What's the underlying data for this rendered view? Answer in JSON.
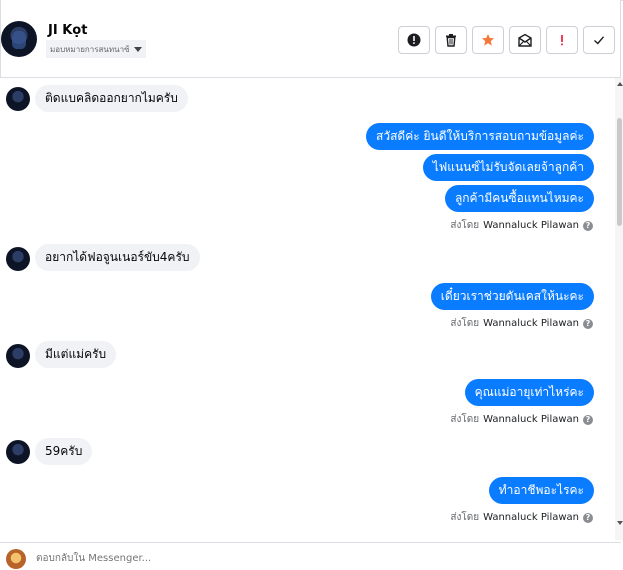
{
  "header": {
    "contact_name": "JI Kọt",
    "assign_label": "มอบหมายการสนทนาซ้"
  },
  "actions": [
    {
      "name": "report-spam",
      "glyph": "!"
    },
    {
      "name": "delete",
      "glyph": "trash"
    },
    {
      "name": "star",
      "glyph": "star"
    },
    {
      "name": "mark-unread",
      "glyph": "envelope"
    },
    {
      "name": "follow-up",
      "glyph": "!"
    },
    {
      "name": "done",
      "glyph": "check"
    }
  ],
  "colors": {
    "outgoing_bubble": "#0a7cff",
    "incoming_bubble": "#f0f2f5",
    "follow_up": "#f02849",
    "star": "#f5793b"
  },
  "messages": [
    {
      "dir": "in",
      "text": "ติดแบคลิดออกยากไมครับ"
    },
    {
      "dir": "out",
      "text": "สวัสดีค่ะ  ยินดีให้บริการสอบถามข้อมูลค่ะ"
    },
    {
      "dir": "out",
      "text": "ไฟแนนซ์ไม่รับจัดเลยจ้าลูกค้า"
    },
    {
      "dir": "out",
      "text": "ลูกค้ามีคนซื้อแทนไหมคะ"
    },
    {
      "dir": "sent",
      "prefix": "ส่งโดย",
      "agent": "Wannaluck Pilawan"
    },
    {
      "dir": "in",
      "text": "อยากได้ฟอจูนเนอร์ขับ4ครับ"
    },
    {
      "dir": "out",
      "text": "เดี๋ยวเราช่วยดันเคสให้นะคะ"
    },
    {
      "dir": "sent",
      "prefix": "ส่งโดย",
      "agent": "Wannaluck Pilawan"
    },
    {
      "dir": "in",
      "text": "มีแต่แม่ครับ"
    },
    {
      "dir": "out",
      "text": "คุณแม่อายุเท่าไหร่คะ"
    },
    {
      "dir": "sent",
      "prefix": "ส่งโดย",
      "agent": "Wannaluck Pilawan"
    },
    {
      "dir": "in",
      "text": "59ครับ"
    },
    {
      "dir": "out",
      "text": "ทำอาชีพอะไรคะ"
    },
    {
      "dir": "sent",
      "prefix": "ส่งโดย",
      "agent": "Wannaluck Pilawan"
    }
  ],
  "composer": {
    "placeholder": "ตอบกลับใน Messenger..."
  }
}
